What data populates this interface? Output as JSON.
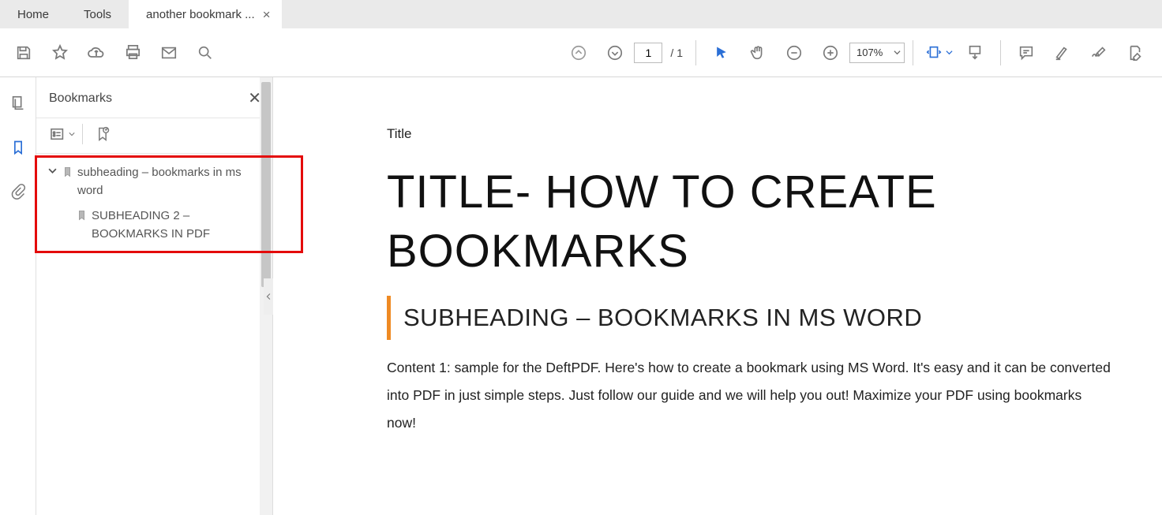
{
  "tabs": {
    "home": "Home",
    "tools": "Tools",
    "doc": "another bookmark ..."
  },
  "toolbar": {
    "page_current": "1",
    "page_total": "/ 1",
    "zoom": "107%"
  },
  "panel": {
    "title": "Bookmarks",
    "items": [
      {
        "label": "subheading – bookmarks in ms word"
      },
      {
        "label": "SUBHEADING 2 – BOOKMARKS IN PDF"
      }
    ]
  },
  "document": {
    "title_label": "Title",
    "heading": "TITLE- HOW TO CREATE BOOKMARKS",
    "subheading": "SUBHEADING – BOOKMARKS IN MS WORD",
    "body": "Content 1:  sample for the DeftPDF. Here's how to create a bookmark using MS Word. It's easy and it can be converted into PDF in just simple steps. Just follow our guide and we will help you out! Maximize your PDF using bookmarks now!"
  }
}
